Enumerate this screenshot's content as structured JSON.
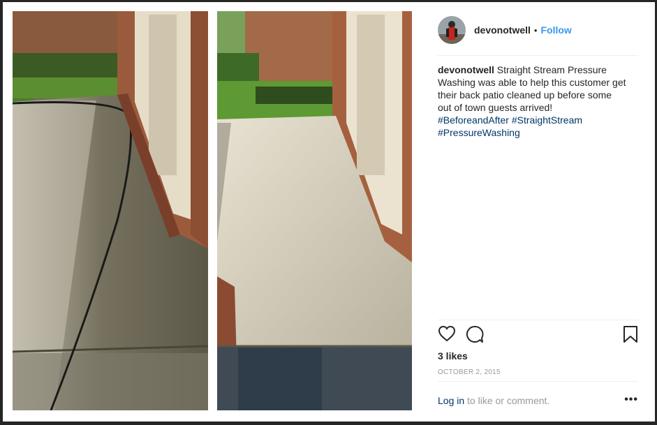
{
  "post": {
    "username": "devonotwell",
    "dot": "•",
    "follow_label": "Follow",
    "caption": {
      "user": "devonotwell",
      "text": "Straight Stream Pressure Washing was able to help this customer get their back patio cleaned up before some out of town guests arrived!",
      "hashtags": [
        "#BeforeandAfter",
        "#StraightStream",
        "#PressureWashing"
      ]
    },
    "likes": "3 likes",
    "date": "OCTOBER 2, 2015",
    "comment": {
      "login_label": "Log in",
      "rest": "to like or comment."
    },
    "more_label": "•••"
  },
  "icons": {
    "like": "heart-icon",
    "comment": "comment-icon",
    "save": "bookmark-icon",
    "more": "more-options-icon"
  },
  "colors": {
    "link_blue": "#3897f0",
    "hashtag": "#003569",
    "text": "#262626",
    "muted": "#999999"
  }
}
